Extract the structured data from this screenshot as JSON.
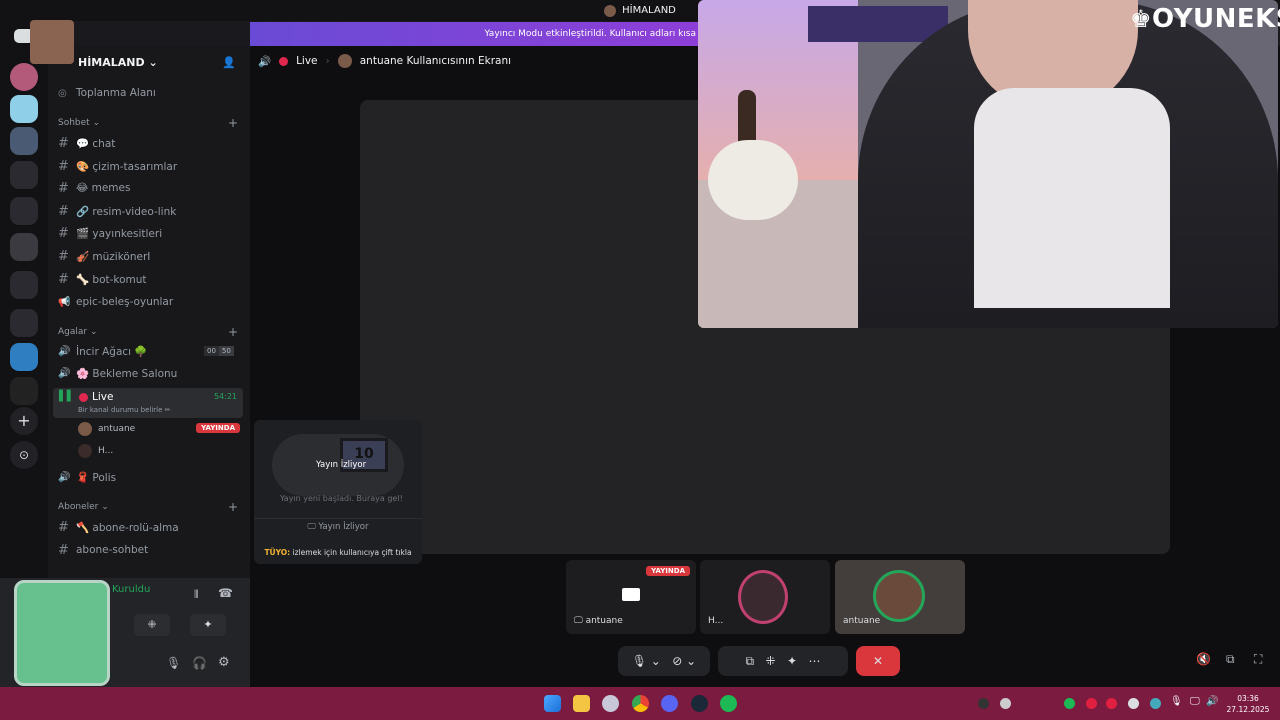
{
  "titlebar": {
    "title": "HİMALAND"
  },
  "banner": {
    "text": "Yayıncı Modu etkinleştirildi. Kullanıcı adları kısa"
  },
  "server": {
    "name": "HİMALAND"
  },
  "channels": {
    "toplanma": "Toplanma Alanı",
    "cat_sohbet": "Sohbet",
    "text": [
      "💬 chat",
      "🎨 çizim-tasarımlar",
      "😂 memes",
      "🔗 resim-video-link",
      "🎬 yayınkesitleri",
      "🎻 müzikönerI",
      "🦴 bot-komut"
    ],
    "epic": "epic-beleş-oyunlar",
    "cat_agalar": "Agalar",
    "incir": "İncir Ağacı 🌳",
    "incir_count_a": "00",
    "incir_count_b": "50",
    "bekleme": "🌸 Bekleme Salonu",
    "live": "Live",
    "live_timer": "54:21",
    "live_status": "Bir kanal durumu belirle ✏",
    "members": [
      {
        "name": "antuane",
        "badge": "YAYINDA"
      },
      {
        "name": "H..."
      }
    ],
    "polis": "🧣 Polis",
    "cat_aboneler": "Aboneler",
    "abone": [
      "🪓 abone-rolü-alma",
      "abone-sohbet"
    ]
  },
  "user_panel": {
    "status": "Kuruldu"
  },
  "header": {
    "live_label": "Live",
    "screen_title": "antuane Kullanıcısının Ekranı"
  },
  "watermark": "OYUNEKS",
  "popup": {
    "art_text": "Yayın İzliyor",
    "monitor_num": "10",
    "sub": "Yayın yeni başladı. Buraya gel!",
    "button": "Yayın İzliyor",
    "tip_label": "TÜYO:",
    "tip": "izlemek için kullanıcıya çift tıkla"
  },
  "tiles": [
    {
      "name": "antuane",
      "badge": "YAYINDA"
    },
    {
      "name": "H..."
    },
    {
      "name": "antuane"
    }
  ],
  "taskbar": {
    "time": "03:36",
    "date": "27.12.2025"
  },
  "colors": {
    "accent": "#5865f2",
    "danger": "#da373c",
    "online": "#23a55a",
    "taskbar": "#7a1b3f"
  }
}
